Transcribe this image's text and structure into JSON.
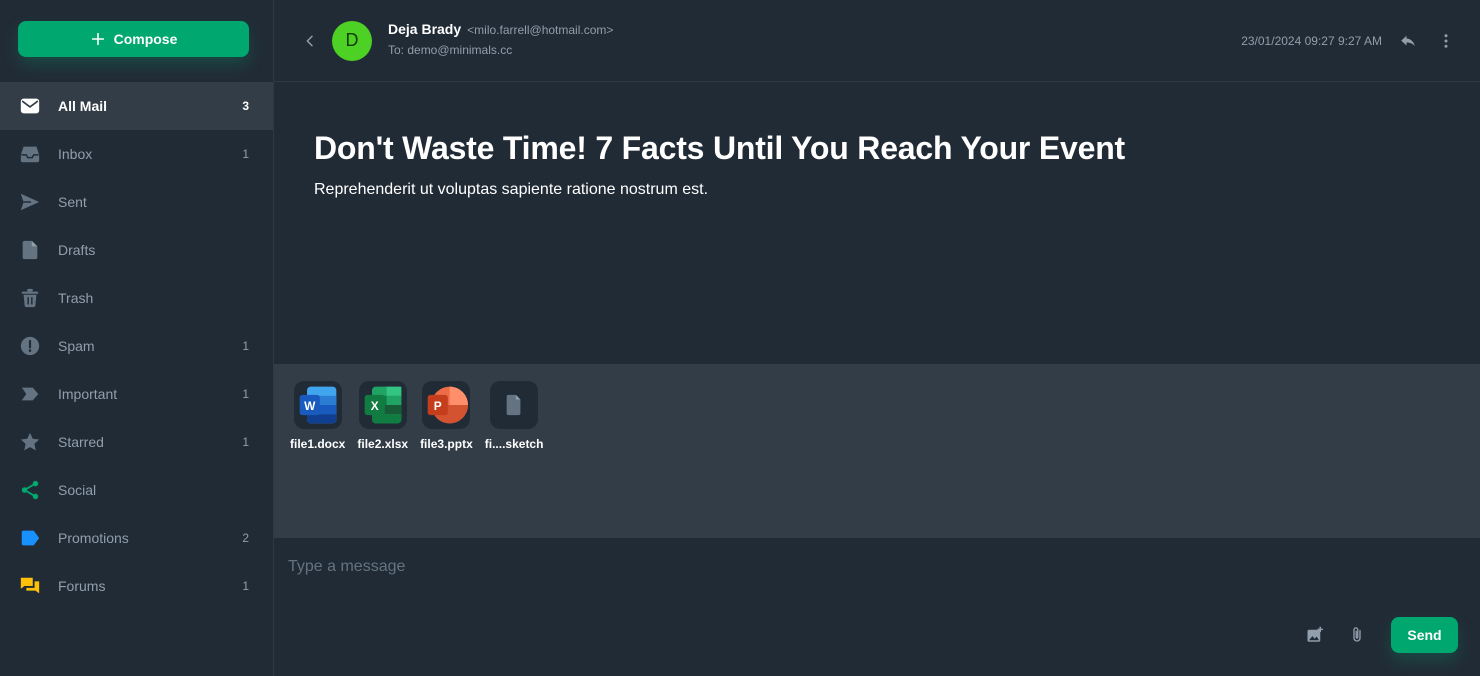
{
  "colors": {
    "accent": "#00a76f",
    "background": "#212b36",
    "panel": "#333d48",
    "muted_text": "#919eab",
    "avatar_bg": "#4ed125"
  },
  "compose": {
    "label": "Compose",
    "icon": "plus-icon"
  },
  "sidebar": {
    "items": [
      {
        "label": "All Mail",
        "count": "3",
        "icon": "mail-icon",
        "active": true
      },
      {
        "label": "Inbox",
        "count": "1",
        "icon": "inbox-icon"
      },
      {
        "label": "Sent",
        "count": "",
        "icon": "send-icon"
      },
      {
        "label": "Drafts",
        "count": "",
        "icon": "file-icon"
      },
      {
        "label": "Trash",
        "count": "",
        "icon": "trash-icon"
      },
      {
        "label": "Spam",
        "count": "1",
        "icon": "alert-icon"
      },
      {
        "label": "Important",
        "count": "1",
        "icon": "label-important-icon"
      },
      {
        "label": "Starred",
        "count": "1",
        "icon": "star-icon"
      },
      {
        "label": "Social",
        "count": "",
        "icon": "share-icon",
        "color": "#00a76f"
      },
      {
        "label": "Promotions",
        "count": "2",
        "icon": "tag-icon",
        "color": "#1890ff"
      },
      {
        "label": "Forums",
        "count": "1",
        "icon": "forum-icon",
        "color": "#ffc107"
      }
    ]
  },
  "mail": {
    "avatar_letter": "D",
    "sender_name": "Deja Brady",
    "sender_email": "<milo.farrell@hotmail.com>",
    "to": "To: demo@minimals.cc",
    "date": "23/01/2024 09:27 9:27 AM",
    "subject": "Don't Waste Time! 7 Facts Until You Reach Your Event",
    "message": "Reprehenderit ut voluptas sapiente ratione nostrum est."
  },
  "attachments": [
    {
      "name": "file1.docx",
      "icon": "word-icon"
    },
    {
      "name": "file2.xlsx",
      "icon": "excel-icon"
    },
    {
      "name": "file3.pptx",
      "icon": "powerpoint-icon"
    },
    {
      "name": "fi....sketch",
      "icon": "generic-file-icon"
    }
  ],
  "composer": {
    "placeholder": "Type a message",
    "send_label": "Send"
  }
}
